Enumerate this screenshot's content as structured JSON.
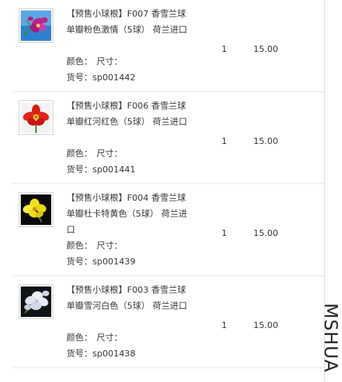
{
  "items": [
    {
      "title": "【预售小球根】F007 香雪兰球单瓣粉色激情（5球） 荷兰进口",
      "color_label": "颜色：",
      "size_label": "尺寸：",
      "sku_label": "货号：",
      "sku": "sp001442",
      "qty": "1",
      "price": "15.00",
      "image": "pink-freesia-flower-icon",
      "image_bg": "#2f7fd0",
      "petal_color": "#c0208a"
    },
    {
      "title": "【预售小球根】F006 香雪兰球单瓣红河红色（5球） 荷兰进口",
      "color_label": "颜色：",
      "size_label": "尺寸：",
      "sku_label": "货号：",
      "sku": "sp001441",
      "qty": "1",
      "price": "15.00",
      "image": "red-freesia-flower-icon",
      "image_bg": "#f2f2f2",
      "petal_color": "#d91c12"
    },
    {
      "title": "【预售小球根】F004 香雪兰球单瓣杜卡特黄色（5球） 荷兰进口",
      "color_label": "颜色：",
      "size_label": "尺寸：",
      "sku_label": "货号：",
      "sku": "sp001439",
      "qty": "1",
      "price": "15.00",
      "image": "yellow-freesia-flower-icon",
      "image_bg": "#0a0a0a",
      "petal_color": "#f2e21a"
    },
    {
      "title": "【预售小球根】F003 香雪兰球单瓣雪河白色（5球） 荷兰进口",
      "color_label": "颜色：",
      "size_label": "尺寸：",
      "sku_label": "货号：",
      "sku": "sp001438",
      "qty": "1",
      "price": "15.00",
      "image": "white-freesia-flower-icon",
      "image_bg": "#101418",
      "petal_color": "#eef1f6"
    }
  ],
  "watermark": "MSHUA"
}
